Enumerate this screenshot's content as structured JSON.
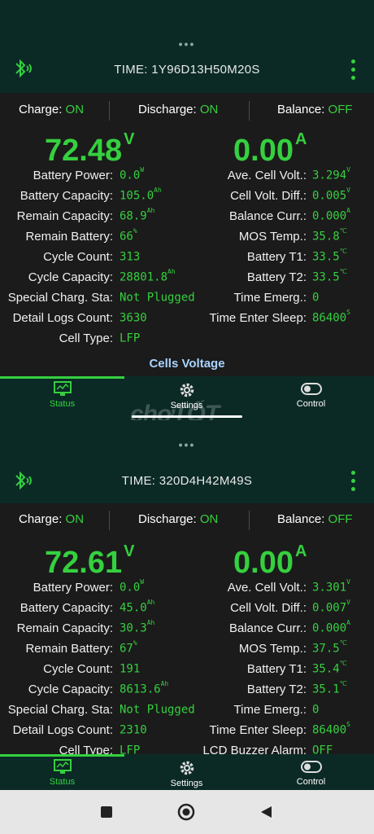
{
  "screens": [
    {
      "dots": "•••",
      "time": "TIME: 1Y96D13H50M20S",
      "status": {
        "charge_label": "Charge:",
        "charge_value": "ON",
        "discharge_label": "Discharge:",
        "discharge_value": "ON",
        "balance_label": "Balance:",
        "balance_value": "OFF"
      },
      "voltage": "72.48",
      "voltage_unit": "V",
      "current": "0.00",
      "current_unit": "A",
      "left": [
        {
          "label": "Battery Power:",
          "value": "0.0",
          "unit": "W"
        },
        {
          "label": "Battery Capacity:",
          "value": "105.0",
          "unit": "Ah"
        },
        {
          "label": "Remain Capacity:",
          "value": "68.9",
          "unit": "Ah"
        },
        {
          "label": "Remain Battery:",
          "value": "66",
          "unit": "%"
        },
        {
          "label": "Cycle Count:",
          "value": "313",
          "unit": ""
        },
        {
          "label": "Cycle Capacity:",
          "value": "28801.8",
          "unit": "Ah"
        },
        {
          "label": "Special Charg. Sta:",
          "value": "Not Plugged",
          "unit": ""
        },
        {
          "label": "Detail Logs Count:",
          "value": "3630",
          "unit": ""
        },
        {
          "label": "Cell Type:",
          "value": "LFP",
          "unit": ""
        }
      ],
      "right": [
        {
          "label": "Ave. Cell Volt.:",
          "value": "3.294",
          "unit": "V"
        },
        {
          "label": "Cell Volt. Diff.:",
          "value": "0.005",
          "unit": "V"
        },
        {
          "label": "Balance Curr.:",
          "value": "0.000",
          "unit": "A"
        },
        {
          "label": "MOS Temp.:",
          "value": "35.8",
          "unit": "℃"
        },
        {
          "label": "Battery T1:",
          "value": "33.5",
          "unit": "℃"
        },
        {
          "label": "Battery T2:",
          "value": "33.5",
          "unit": "℃"
        },
        {
          "label": "Time Emerg.:",
          "value": "0",
          "unit": ""
        },
        {
          "label": "Time Enter Sleep:",
          "value": "86400",
          "unit": "S"
        }
      ],
      "cells_voltage": "Cells Voltage",
      "nav": {
        "status": "Status",
        "settings": "Settings",
        "control": "Control"
      }
    },
    {
      "dots": "•••",
      "time": "TIME: 320D4H42M49S",
      "status": {
        "charge_label": "Charge:",
        "charge_value": "ON",
        "discharge_label": "Discharge:",
        "discharge_value": "ON",
        "balance_label": "Balance:",
        "balance_value": "OFF"
      },
      "voltage": "72.61",
      "voltage_unit": "V",
      "current": "0.00",
      "current_unit": "A",
      "left": [
        {
          "label": "Battery Power:",
          "value": "0.0",
          "unit": "W"
        },
        {
          "label": "Battery Capacity:",
          "value": "45.0",
          "unit": "Ah"
        },
        {
          "label": "Remain Capacity:",
          "value": "30.3",
          "unit": "Ah"
        },
        {
          "label": "Remain Battery:",
          "value": "67",
          "unit": "%"
        },
        {
          "label": "Cycle Count:",
          "value": "191",
          "unit": ""
        },
        {
          "label": "Cycle Capacity:",
          "value": "8613.6",
          "unit": "Ah"
        },
        {
          "label": "Special Charg. Sta:",
          "value": "Not Plugged",
          "unit": ""
        },
        {
          "label": "Detail Logs Count:",
          "value": "2310",
          "unit": ""
        },
        {
          "label": "Cell Type:",
          "value": "LFP",
          "unit": ""
        }
      ],
      "right": [
        {
          "label": "Ave. Cell Volt.:",
          "value": "3.301",
          "unit": "V"
        },
        {
          "label": "Cell Volt. Diff.:",
          "value": "0.007",
          "unit": "V"
        },
        {
          "label": "Balance Curr.:",
          "value": "0.000",
          "unit": "A"
        },
        {
          "label": "MOS Temp.:",
          "value": "37.5",
          "unit": "℃"
        },
        {
          "label": "Battery T1:",
          "value": "35.4",
          "unit": "℃"
        },
        {
          "label": "Battery T2:",
          "value": "35.1",
          "unit": "℃"
        },
        {
          "label": "Time Emerg.:",
          "value": "0",
          "unit": ""
        },
        {
          "label": "Time Enter Sleep:",
          "value": "86400",
          "unit": "S"
        },
        {
          "label": "LCD Buzzer Alarm:",
          "value": "OFF",
          "unit": ""
        }
      ],
      "nav": {
        "status": "Status",
        "settings": "Settings",
        "control": "Control"
      }
    }
  ],
  "watermark": "chợTỐT",
  "colors": {
    "accent": "#35d03f",
    "header_bg": "#0b2a26",
    "body_bg": "#1b1b1b",
    "cells_voltage": "#a8d4ff"
  }
}
